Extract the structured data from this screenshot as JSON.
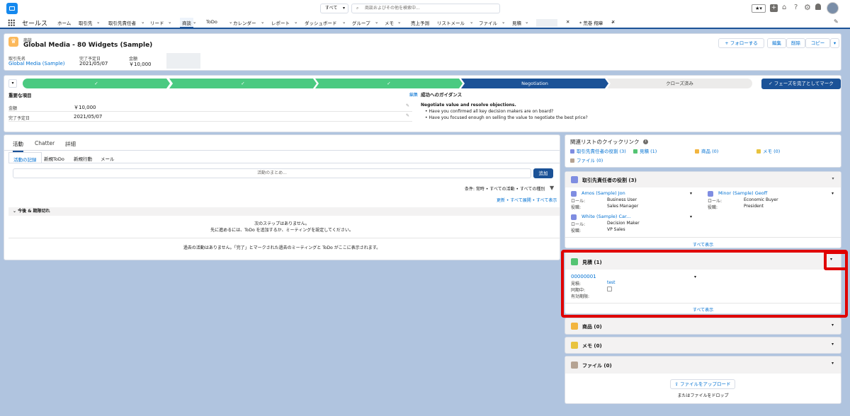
{
  "topbar": {
    "scope": "すべて",
    "search_placeholder": "商談およびその他を検索中..."
  },
  "app": {
    "name": "セールス"
  },
  "nav": [
    {
      "label": "ホーム",
      "chev": false
    },
    {
      "label": "取引先",
      "chev": true
    },
    {
      "label": "取引先責任者",
      "chev": true
    },
    {
      "label": "リード",
      "chev": true
    },
    {
      "label": "商談",
      "chev": true
    },
    {
      "label": "ToDo",
      "chev": true
    },
    {
      "label": "カレンダー",
      "chev": true
    },
    {
      "label": "レポート",
      "chev": true
    },
    {
      "label": "ダッシュボード",
      "chev": true
    },
    {
      "label": "グループ",
      "chev": true
    },
    {
      "label": "メモ",
      "chev": true
    },
    {
      "label": "売上予測",
      "chev": false
    },
    {
      "label": "リストメール",
      "chev": true
    },
    {
      "label": "ファイル",
      "chev": true
    },
    {
      "label": "見積",
      "chev": true
    },
    {
      "label": "* 荒巻 翔章",
      "chev": true
    }
  ],
  "record": {
    "type": "商談",
    "title": "Global Media - 80 Widgets (Sample)",
    "buttons": {
      "follow": "+ フォローする",
      "edit": "編集",
      "delete": "削除",
      "copy": "コピー"
    },
    "fields": [
      {
        "label": "取引先名",
        "value": "Global Media (Sample)"
      },
      {
        "label": "完了予定日",
        "value": "2021/05/07"
      },
      {
        "label": "金額",
        "value": "￥10,000"
      }
    ]
  },
  "path": {
    "stages": [
      "",
      "",
      "",
      "Negotiation",
      "クローズ済み"
    ],
    "complete_button": "フェーズを完了としてマーク"
  },
  "key_fields": {
    "title": "重要な項目",
    "items": [
      {
        "label": "金額",
        "value": "￥10,000"
      },
      {
        "label": "完了予定日",
        "value": "2021/05/07"
      }
    ]
  },
  "guidance": {
    "edit": "編集",
    "title": "成功へのガイダンス",
    "heading": "Negotiate value and resolve objections.",
    "bullets": [
      "Have you confirmed all key decision makers are on board?",
      "Have you focused enough on selling the value to negotiate the best price?"
    ]
  },
  "activity": {
    "tabs": [
      "活動",
      "Chatter",
      "詳細"
    ],
    "subtabs": [
      "活動の記録",
      "新規ToDo",
      "新規行動",
      "メール"
    ],
    "input_placeholder": "活動のまとめ...",
    "add": "追加",
    "filter": "条件: 常時 • すべての活動 • すべての種別",
    "links": "更新 • すべて展開 • すべて表示",
    "upcoming": "今後 & 期限切れ",
    "empty1": "次のステップはありません。",
    "empty2": "先に進めるには、ToDo を追加するか、ミーティングを設定してください。",
    "past": "過去の活動はありません。「完了」とマークされた過去のミーティングと ToDo がここに表示されます。"
  },
  "quicklinks": {
    "title": "関連リストのクイックリンク",
    "items": [
      {
        "label": "取引先責任者の役割 (3)",
        "color": "#7f8de1"
      },
      {
        "label": "見積 (1)",
        "color": "#54c473"
      },
      {
        "label": "商品 (0)",
        "color": "#f2b53f"
      },
      {
        "label": "メモ (0)",
        "color": "#e8c33f"
      },
      {
        "label": "ファイル (0)",
        "color": "#b5a393"
      }
    ]
  },
  "contact_roles": {
    "title": "取引先責任者の役割 (3)",
    "people": [
      {
        "name": "Amos (Sample) Jon",
        "role_label": "ロール:",
        "role": "Business User",
        "title_label": "役職:",
        "title": "Sales Manager"
      },
      {
        "name": "Minor (Sample) Geoff",
        "role_label": "ロール:",
        "role": "Economic Buyer",
        "title_label": "役職:",
        "title": "President"
      },
      {
        "name": "White (Sample) Car...",
        "role_label": "ロール:",
        "role": "Decision Maker",
        "title_label": "役職:",
        "title": "VP Sales"
      }
    ],
    "view_all": "すべて表示"
  },
  "quotes": {
    "title": "見積 (1)",
    "number": "00000001",
    "f1_label": "見積:",
    "f1": "test",
    "f2_label": "同期中:",
    "f3_label": "有効期限:",
    "view_all": "すべて表示"
  },
  "products": {
    "title": "商品 (0)"
  },
  "notes": {
    "title": "メモ (0)"
  },
  "files": {
    "title": "ファイル (0)",
    "upload": "ファイルをアップロード",
    "drop": "またはファイルをドロップ"
  },
  "colors": {
    "brand": "#1b5297",
    "accent": "#0070d2",
    "done": "#4bca81",
    "highlight": "#e00000"
  }
}
